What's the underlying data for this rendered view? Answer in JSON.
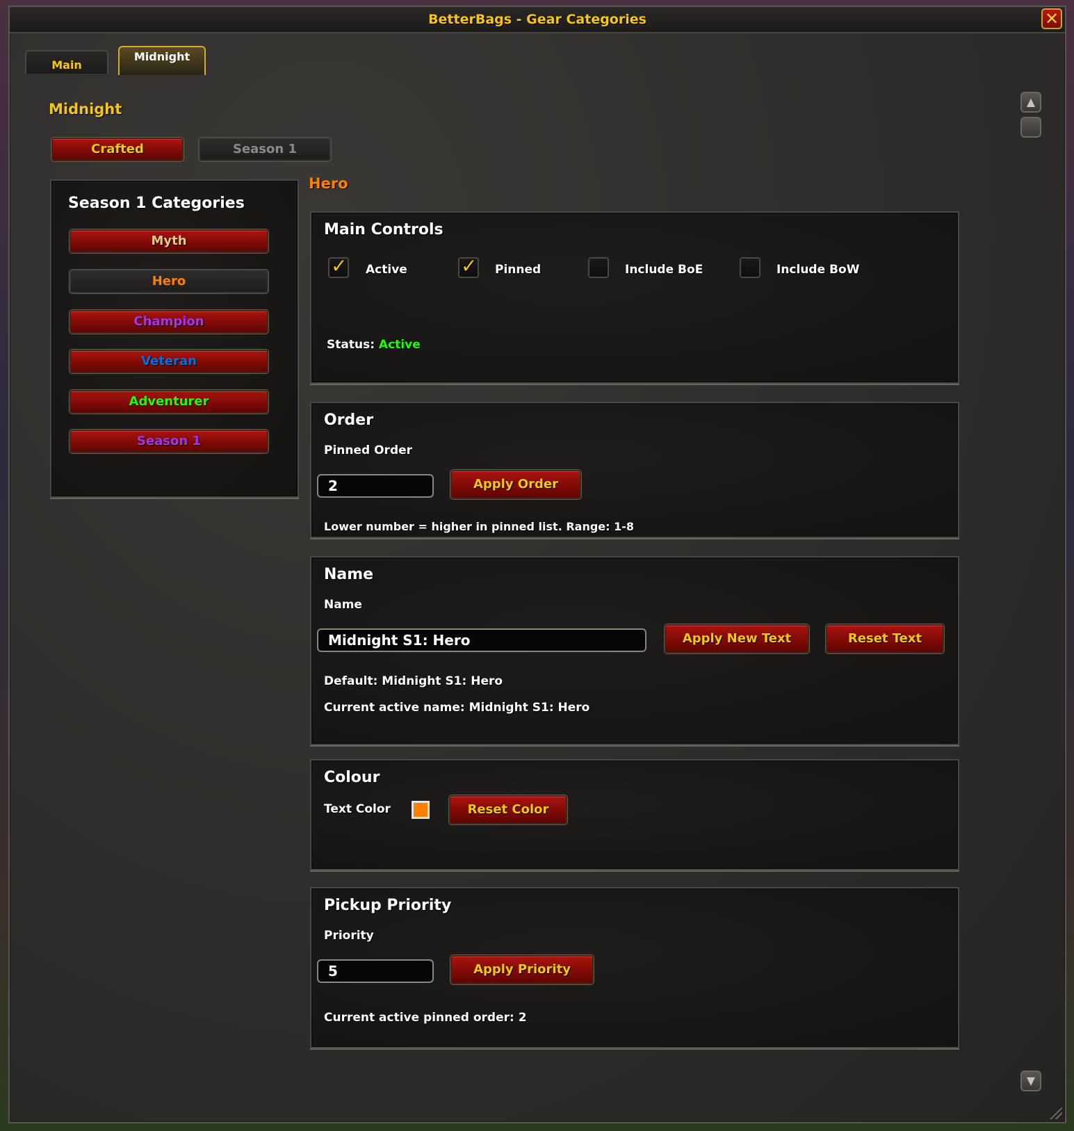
{
  "window": {
    "title": "BetterBags - Gear Categories",
    "close_label": "✕"
  },
  "tabs": [
    {
      "label": "Main",
      "active": false
    },
    {
      "label": "Midnight",
      "active": true
    }
  ],
  "page": {
    "title": "Midnight",
    "subtabs": [
      {
        "label": "Crafted",
        "active": true
      },
      {
        "label": "Season 1",
        "active": false
      }
    ]
  },
  "categories": {
    "heading": "Season 1 Categories",
    "items": [
      {
        "label": "Myth",
        "color": "#e6cc80",
        "selected": false
      },
      {
        "label": "Hero",
        "color": "#ff8000",
        "selected": true
      },
      {
        "label": "Champion",
        "color": "#a335ee",
        "selected": false
      },
      {
        "label": "Veteran",
        "color": "#0070dd",
        "selected": false
      },
      {
        "label": "Adventurer",
        "color": "#1eff00",
        "selected": false
      },
      {
        "label": "Season 1",
        "color": "#a335ee",
        "selected": false
      }
    ]
  },
  "detail": {
    "title": "Hero",
    "title_color": "#ff8000",
    "main_controls": {
      "heading": "Main Controls",
      "checkboxes": [
        {
          "label": "Active",
          "checked": true
        },
        {
          "label": "Pinned",
          "checked": true
        },
        {
          "label": "Include BoE",
          "checked": false
        },
        {
          "label": "Include BoW",
          "checked": false
        }
      ],
      "status_label": "Status:",
      "status_value": "Active",
      "status_color": "#1eff00"
    },
    "order": {
      "heading": "Order",
      "field_label": "Pinned Order",
      "value": "2",
      "apply_label": "Apply Order",
      "help": "Lower number = higher in pinned list. Range: 1-8"
    },
    "name": {
      "heading": "Name",
      "field_label": "Name",
      "value": "Midnight S1: Hero",
      "apply_label": "Apply New Text",
      "reset_label": "Reset Text",
      "default_text": "Default: Midnight S1: Hero",
      "current_text": "Current active name: Midnight S1: Hero"
    },
    "colour": {
      "heading": "Colour",
      "field_label": "Text Color",
      "swatch": "#ff8000",
      "reset_label": "Reset Color"
    },
    "pickup": {
      "heading": "Pickup Priority",
      "field_label": "Priority",
      "value": "5",
      "apply_label": "Apply Priority",
      "current_text": "Current active pinned order: 2"
    }
  },
  "scroll_icons": [
    "scroll-up-icon",
    "scroll-thumb",
    "scroll-down-icon"
  ]
}
